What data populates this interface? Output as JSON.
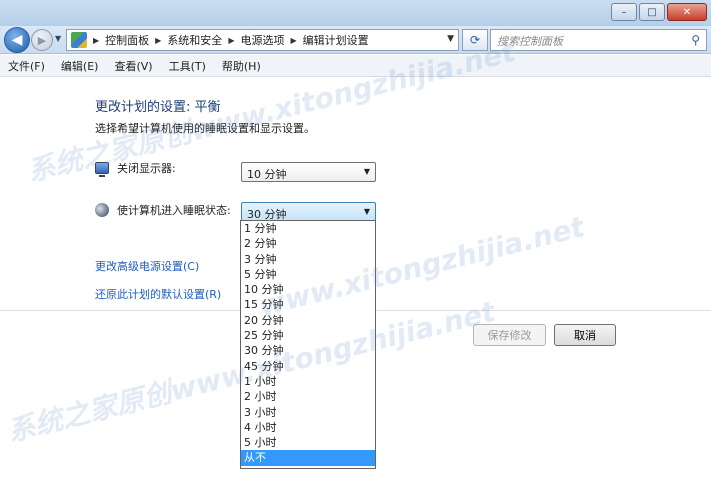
{
  "window": {
    "minimize": "–",
    "maximize": "□",
    "close": "✕"
  },
  "navbar": {
    "back": "◀",
    "forward": "▶",
    "breadcrumbs": [
      "控制面板",
      "系统和安全",
      "电源选项",
      "编辑计划设置"
    ],
    "search_placeholder": "搜索控制面板"
  },
  "menubar": {
    "items": [
      "文件(F)",
      "编辑(E)",
      "查看(V)",
      "工具(T)",
      "帮助(H)"
    ]
  },
  "page": {
    "title": "更改计划的设置: 平衡",
    "description": "选择希望计算机使用的睡眠设置和显示设置。",
    "display_off_label": "关闭显示器:",
    "display_off_value": "10 分钟",
    "sleep_label": "使计算机进入睡眠状态:",
    "sleep_value": "30 分钟",
    "advanced_link": "更改高级电源设置(C)",
    "restore_link": "还原此计划的默认设置(R)",
    "save_button": "保存修改",
    "cancel_button": "取消"
  },
  "dropdown": {
    "options": [
      "1 分钟",
      "2 分钟",
      "3 分钟",
      "5 分钟",
      "10 分钟",
      "15 分钟",
      "20 分钟",
      "25 分钟",
      "30 分钟",
      "45 分钟",
      "1 小时",
      "2 小时",
      "3 小时",
      "4 小时",
      "5 小时",
      "从不"
    ],
    "highlighted": "从不"
  },
  "watermark": {
    "text_1": "系统之家原创www.xitongzhijia.net",
    "text_2": "www.xitongzhijia.net",
    "text_3": "系统之家原创www.xitongzhijia.net"
  },
  "colors": {
    "link": "#1c5ec1",
    "title": "#1e3f78",
    "highlight": "#3399ff"
  }
}
